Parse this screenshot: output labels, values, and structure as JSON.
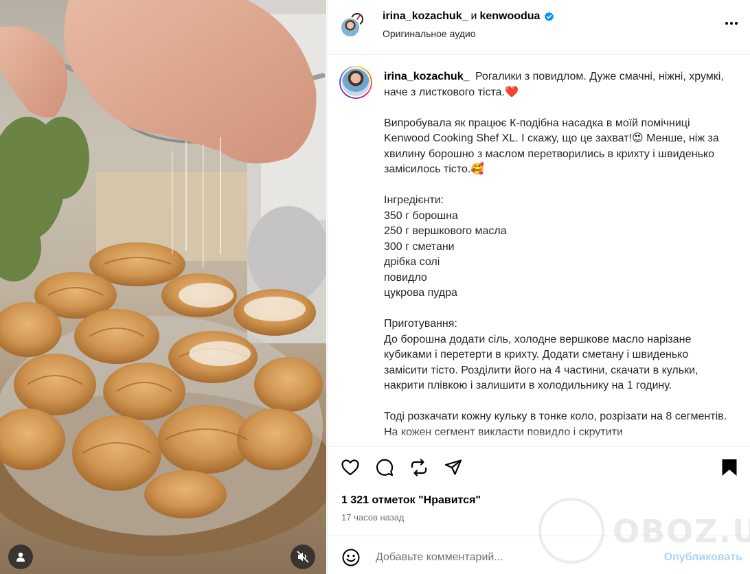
{
  "header": {
    "author": "irina_kozachuk_",
    "conjunction": "и",
    "collaborator": "kenwoodua",
    "audio": "Оригинальное аудио"
  },
  "caption": {
    "username": "irina_kozachuk_",
    "body": "Рогалики з повидлом. Дуже смачні, ніжні, хрумкі, наче з листкового тіста.❤️\n\nВипробувала як працює К-подібна насадка в моїй помічниці Kenwood Cooking Shef XL. І скажу, що це захват!😍 Менше, ніж за хвилину борошно з маслом перетворились в крихту і швиденько замісилось тісто.🥰\n\nІнгредієнти:\n350 г борошна\n250 г вершкового масла\n300 г сметани\nдрібка солі\nповидло\nцукрова пудра\n\nПриготування:\nДо борошна додати сіль, холодне вершкове масло нарізане кубиками і перетерти в крихту. Додати сметану і швиденько замісити тісто. Розділити його на 4 частини, скачати в кульки, накрити плівкою і залишити в холодильнику на 1 годину.\n\nТоді розкачати кожну кульку в тонке коло, розрізати на 8 сегментів. На кожен сегмент викласти повидло і скрутити"
  },
  "actions": {
    "likes": "1 321 отметок \"Нравится\"",
    "time": "17 часов назад",
    "icons": [
      "heart-icon",
      "comment-icon",
      "repost-icon",
      "share-icon",
      "bookmark-icon"
    ]
  },
  "comment": {
    "placeholder": "Добавьте комментарий...",
    "post_label": "Опубликовать"
  },
  "watermark": {
    "text": "OBOZ.UA"
  },
  "colors": {
    "verified": "#0095f6",
    "post_disabled": "#aed2f8",
    "secondary_text": "#737373",
    "divider": "#efefef"
  }
}
